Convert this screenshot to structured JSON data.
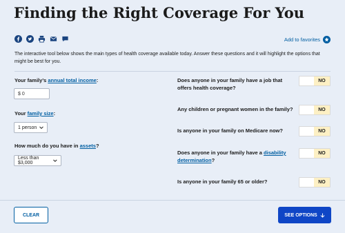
{
  "title": "Finding the Right Coverage For You",
  "share_icons": [
    "facebook-icon",
    "twitter-icon",
    "print-icon",
    "email-icon",
    "comment-icon"
  ],
  "favorites_label": "Add to favorites",
  "intro": "The interactive tool below shows the main types of health coverage available today. Answer these questions and it will highlight the options that might be best for you.",
  "income": {
    "prefix": "Your family’s ",
    "link": "annual total income",
    "suffix": ":",
    "value": "$ 0"
  },
  "family_size": {
    "prefix": "Your ",
    "link": "family size",
    "suffix": ":",
    "value": "1 person"
  },
  "assets": {
    "prefix": "How much do you have in ",
    "link": "assets",
    "suffix": "?",
    "value": "Less than $3,000"
  },
  "questions": [
    {
      "text": "Does anyone in your family have a job that offers health coverage?",
      "answer": "NO"
    },
    {
      "text": "Any children or pregnant women in the family?",
      "answer": "NO"
    },
    {
      "text": "Is anyone in your family on Medicare now?",
      "answer": "NO"
    },
    {
      "prefix": "Does anyone in your family have a ",
      "link": "disability determination",
      "suffix": "?",
      "answer": "NO"
    },
    {
      "text": "Is anyone in your family 65 or older?",
      "answer": "NO"
    }
  ],
  "buttons": {
    "clear": "CLEAR",
    "see_options": "SEE OPTIONS"
  },
  "colors": {
    "background": "#e8eef7",
    "link": "#005ea2",
    "primary_button": "#0f46c6",
    "toggle_no": "#fdf0c4"
  }
}
